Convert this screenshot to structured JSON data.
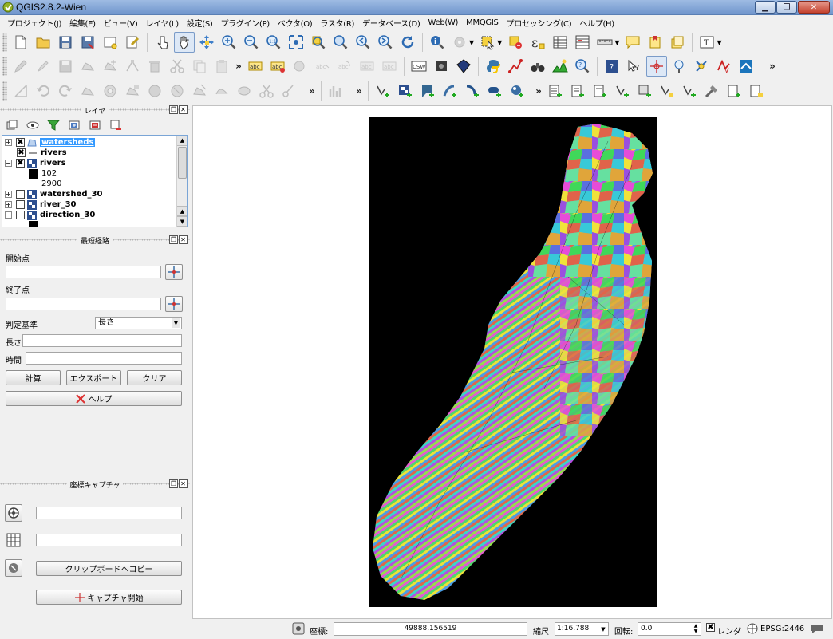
{
  "window": {
    "title": "QGIS2.8.2-Wien"
  },
  "menu": [
    "プロジェクト(J)",
    "編集(E)",
    "ビュー(V)",
    "レイヤ(L)",
    "設定(S)",
    "プラグイン(P)",
    "ベクタ(O)",
    "ラスタ(R)",
    "データベース(D)",
    "Web(W)",
    "MMQGIS",
    "プロセッシング(C)",
    "ヘルプ(H)"
  ],
  "toolbar_overflow": "»",
  "layers_panel": {
    "title": "レイヤ",
    "items": [
      {
        "name": "watersheds",
        "checked": true,
        "selected": true
      },
      {
        "name": "rivers",
        "checked": true
      },
      {
        "name": "rivers",
        "checked": true
      },
      {
        "name": "102"
      },
      {
        "name": "2900"
      },
      {
        "name": "watershed_30",
        "checked": false
      },
      {
        "name": "river_30",
        "checked": false
      },
      {
        "name": "direction_30",
        "checked": false
      }
    ]
  },
  "route_panel": {
    "title": "最短経路",
    "start_label": "開始点",
    "end_label": "終了点",
    "criterion_label": "判定基準",
    "criterion_value": "長さ",
    "length_label": "長さ",
    "time_label": "時間",
    "calc_button": "計算",
    "export_button": "エクスポート",
    "clear_button": "クリア",
    "help_button": "ヘルプ"
  },
  "capture_panel": {
    "title": "座標キャプチャ",
    "copy_button": "クリップボードへコピー",
    "start_button": "キャプチャ開始"
  },
  "status": {
    "coord_label": "座標:",
    "coord_value": "49888,156519",
    "scale_label": "縮尺",
    "scale_value": "1:16,788",
    "rotation_label": "回転:",
    "rotation_value": "0.0",
    "render_label": "レンダ",
    "crs": "EPSG:2446"
  },
  "colors": {
    "selection": "#3399ff",
    "map_background": "#000000"
  }
}
